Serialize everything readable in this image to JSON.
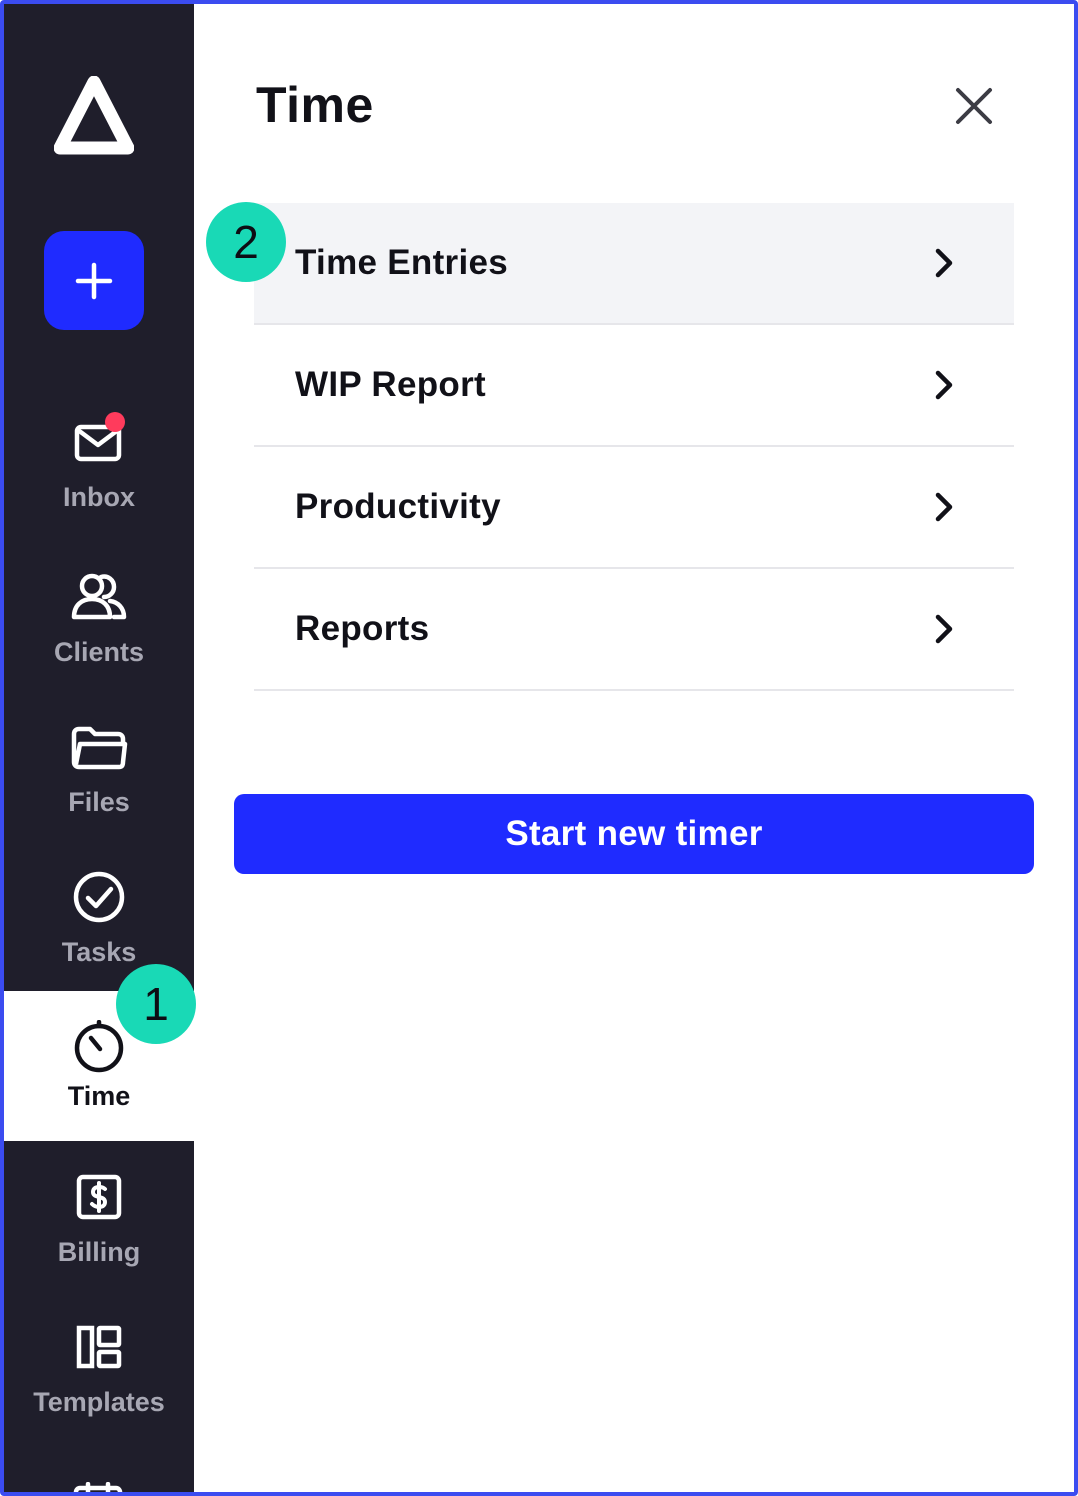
{
  "sidebar": {
    "logo_icon": "app-logo-triangle",
    "add_button_icon": "plus-icon",
    "items": [
      {
        "label": "Inbox",
        "icon": "mail-icon",
        "notification": true
      },
      {
        "label": "Clients",
        "icon": "users-icon"
      },
      {
        "label": "Files",
        "icon": "folder-icon"
      },
      {
        "label": "Tasks",
        "icon": "check-circle-icon"
      },
      {
        "label": "Time",
        "icon": "stopwatch-icon",
        "active": true
      },
      {
        "label": "Billing",
        "icon": "dollar-icon"
      },
      {
        "label": "Templates",
        "icon": "layout-icon"
      }
    ]
  },
  "panel": {
    "title": "Time",
    "close_icon": "close-icon",
    "menu": [
      {
        "label": "Time Entries",
        "highlighted": true
      },
      {
        "label": "WIP Report"
      },
      {
        "label": "Productivity"
      },
      {
        "label": "Reports"
      }
    ],
    "primary_button": "Start new timer"
  },
  "badges": {
    "step1": "1",
    "step2": "2"
  },
  "colors": {
    "sidebar_bg": "#1f1e2b",
    "accent_blue": "#1f2bff",
    "badge_teal": "#19d9b6",
    "notification_red": "#ff3b5c",
    "frame_border": "#3b4cf0"
  }
}
